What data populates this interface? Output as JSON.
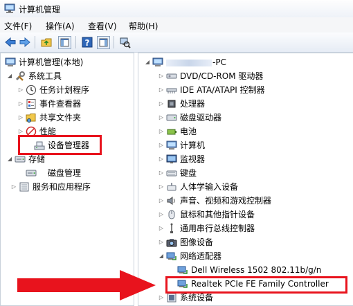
{
  "window": {
    "title": "计算机管理"
  },
  "menu": [
    "文件(F)",
    "操作(A)",
    "查看(V)",
    "帮助(H)"
  ],
  "left_tree": {
    "root": "计算机管理(本地)",
    "system_tools": "系统工具",
    "task_scheduler": "任务计划程序",
    "event_viewer": "事件查看器",
    "shared_folders": "共享文件夹",
    "performance": "性能",
    "device_manager": "设备管理器",
    "storage": "存储",
    "disk_management": "磁盘管理",
    "services_apps": "服务和应用程序"
  },
  "right_tree": {
    "computer_suffix": "-PC",
    "categories": [
      {
        "label": "DVD/CD-ROM 驱动器",
        "icon": "dvd-drive-icon"
      },
      {
        "label": "IDE ATA/ATAPI 控制器",
        "icon": "ide-controller-icon"
      },
      {
        "label": "处理器",
        "icon": "processor-icon"
      },
      {
        "label": "磁盘驱动器",
        "icon": "disk-drive-icon"
      },
      {
        "label": "电池",
        "icon": "battery-icon"
      },
      {
        "label": "计算机",
        "icon": "computer-icon"
      },
      {
        "label": "监视器",
        "icon": "monitor-icon"
      },
      {
        "label": "键盘",
        "icon": "keyboard-icon"
      },
      {
        "label": "人体学输入设备",
        "icon": "hid-icon"
      },
      {
        "label": "声音、视频和游戏控制器",
        "icon": "sound-icon"
      },
      {
        "label": "鼠标和其他指针设备",
        "icon": "mouse-icon"
      },
      {
        "label": "通用串行总线控制器",
        "icon": "usb-icon"
      },
      {
        "label": "图像设备",
        "icon": "camera-icon"
      },
      {
        "label": "网络适配器",
        "icon": "network-adapter-icon"
      }
    ],
    "network_children": [
      "Dell Wireless 1502 802.11b/g/n",
      "Realtek PCIe FE Family Controller"
    ],
    "system_devices": "系统设备"
  },
  "colors": {
    "highlight_red": "#e8131d"
  }
}
